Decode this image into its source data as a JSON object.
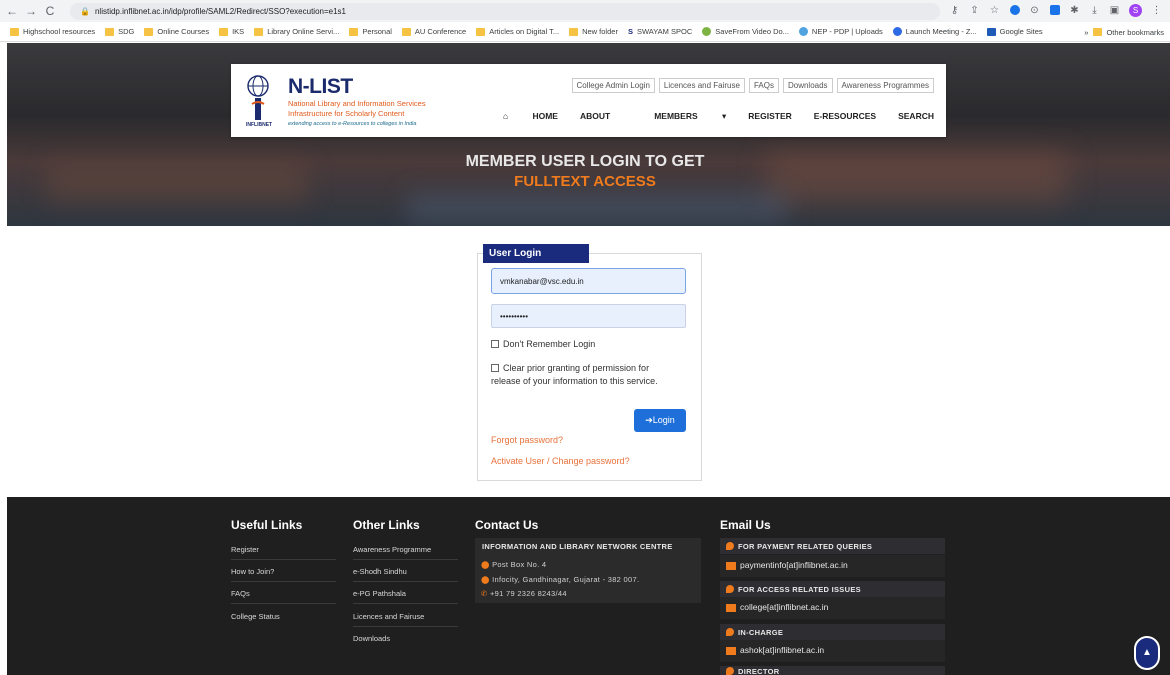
{
  "browser": {
    "url": "nlistidp.inflibnet.ac.in/idp/profile/SAML2/Redirect/SSO?execution=e1s1",
    "profile_initial": "S",
    "bookmarks": [
      "Highschool resources",
      "SDG",
      "Online Courses",
      "IKS",
      "Library Online Servi...",
      "Personal",
      "AU Conference",
      "Articles on Digital T...",
      "New folder",
      "SWAYAM SPOC",
      "SaveFrom Video Do...",
      "NEP - PDP | Uploads",
      "Launch Meeting - Z...",
      "Google Sites"
    ],
    "other_bookmarks": "Other bookmarks"
  },
  "header": {
    "brand": "N-LIST",
    "line1": "National Library and Information Services",
    "line2": "Infrastructure for Scholarly Content",
    "tagline": "extending access to e-Resources to colleges in India",
    "org": "INFLIBNET",
    "top_links": [
      "College Admin Login",
      "Licences and Fairuse",
      "FAQs",
      "Downloads",
      "Awareness Programmes"
    ],
    "nav": [
      "HOME",
      "ABOUT",
      "MEMBERS",
      "REGISTER",
      "E-RESOURCES",
      "SEARCH"
    ]
  },
  "hero": {
    "line1": "MEMBER USER LOGIN TO GET",
    "line2": "FULLTEXT ACCESS"
  },
  "login": {
    "title": "User Login",
    "username": "vmkanabar@vsc.edu.in",
    "password": "••••••••••",
    "dont_remember": "Don't Remember Login",
    "clear_line1": "Clear prior granting of permission for",
    "clear_line2": "release of your information to this service.",
    "button": "Login",
    "forgot": "Forgot password?",
    "activate": "Activate User / Change password?"
  },
  "footer": {
    "useful_title": "Useful Links",
    "useful": [
      "Register",
      "How to Join?",
      "FAQs",
      "College Status"
    ],
    "other_title": "Other Links",
    "other": [
      "Awareness Programme",
      "e-Shodh Sindhu",
      "e-PG Pathshala",
      "Licences and Fairuse",
      "Downloads"
    ],
    "contact_title": "Contact Us",
    "contact_org": "INFORMATION AND LIBRARY NETWORK CENTRE",
    "contact_lines": [
      "Post Box No. 4",
      "Infocity, Gandhinagar, Gujarat - 382 007.",
      "+91 79 2326 8243/44"
    ],
    "email_title": "Email Us",
    "email_items": [
      {
        "label": "FOR PAYMENT RELATED QUERIES",
        "email": "paymentinfo[at]inflibnet.ac.in"
      },
      {
        "label": "FOR ACCESS RELATED ISSUES",
        "email": "college[at]inflibnet.ac.in"
      },
      {
        "label": "IN-CHARGE",
        "email": "ashok[at]inflibnet.ac.in"
      },
      {
        "label": "DIRECTOR",
        "email": ""
      }
    ]
  }
}
